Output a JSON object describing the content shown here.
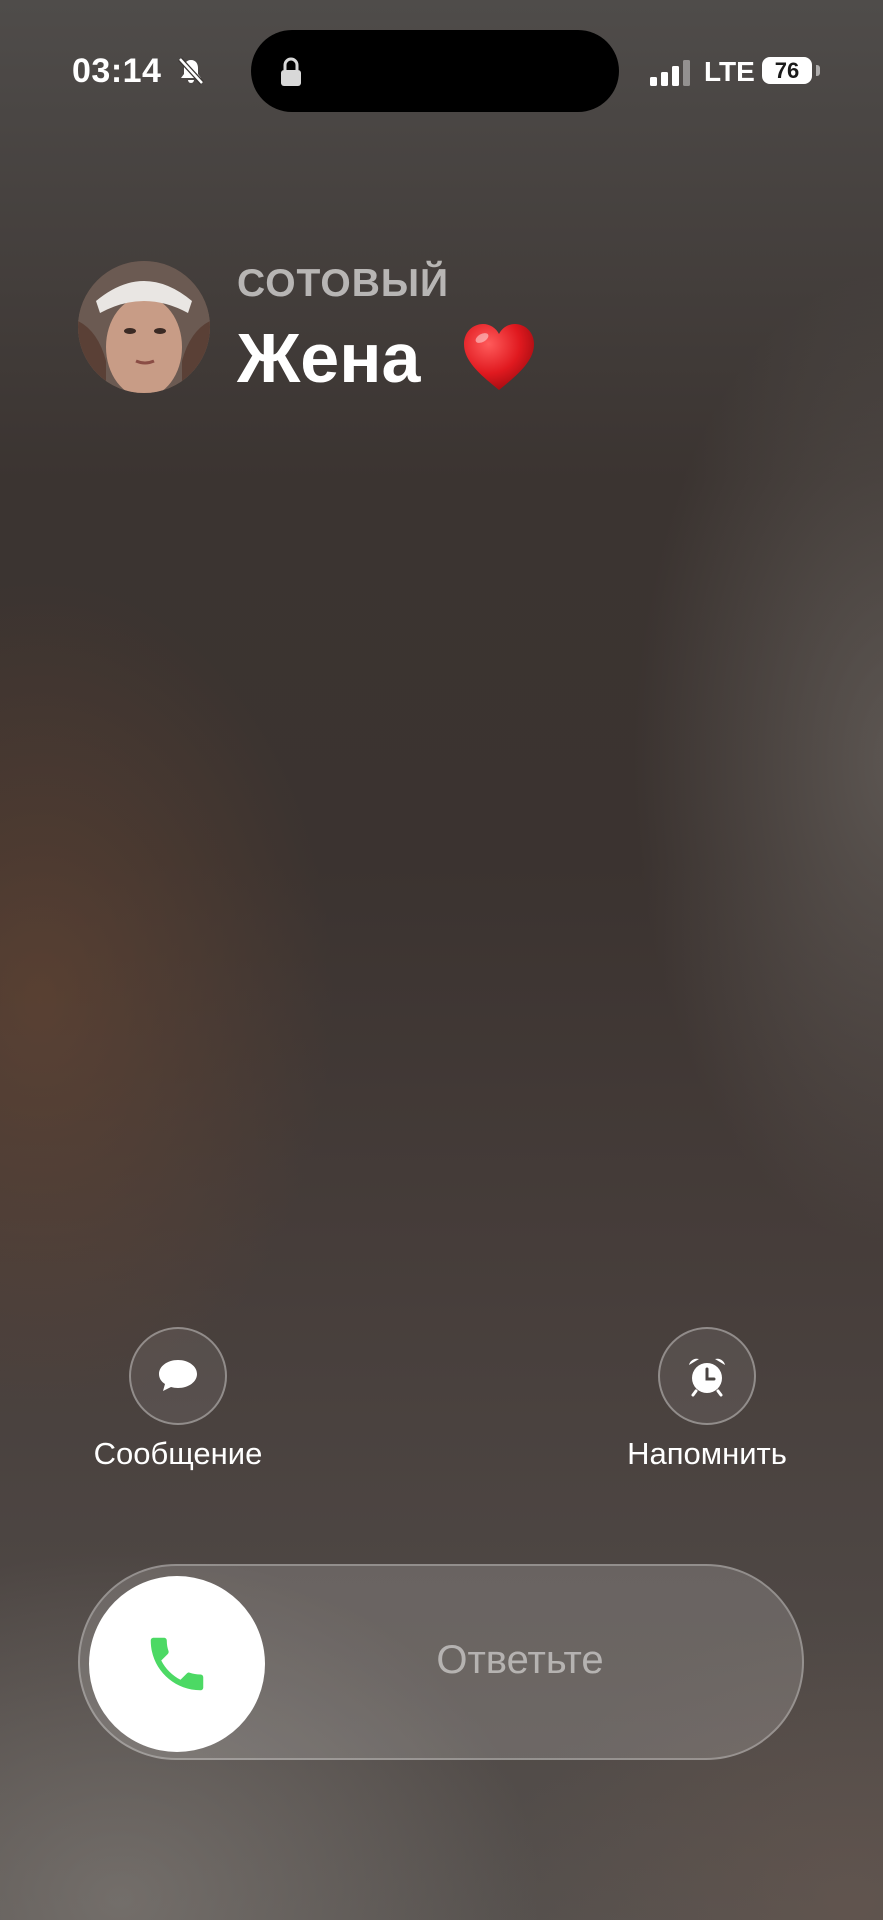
{
  "status_bar": {
    "time": "03:14",
    "network": "LTE",
    "battery_percent": "76",
    "icons": [
      "bell-slash-icon",
      "lock-icon",
      "signal-bars-icon",
      "battery-icon"
    ]
  },
  "caller": {
    "call_type": "СОТОВЫЙ",
    "name": "Жена",
    "emoji_icon": "red-heart-icon"
  },
  "actions": {
    "message_label": "Сообщение",
    "message_icon": "message-bubble-icon",
    "remind_label": "Напомнить",
    "remind_icon": "alarm-clock-icon"
  },
  "slider": {
    "label": "Ответьте",
    "icon": "phone-icon",
    "icon_color": "#4cd964"
  }
}
